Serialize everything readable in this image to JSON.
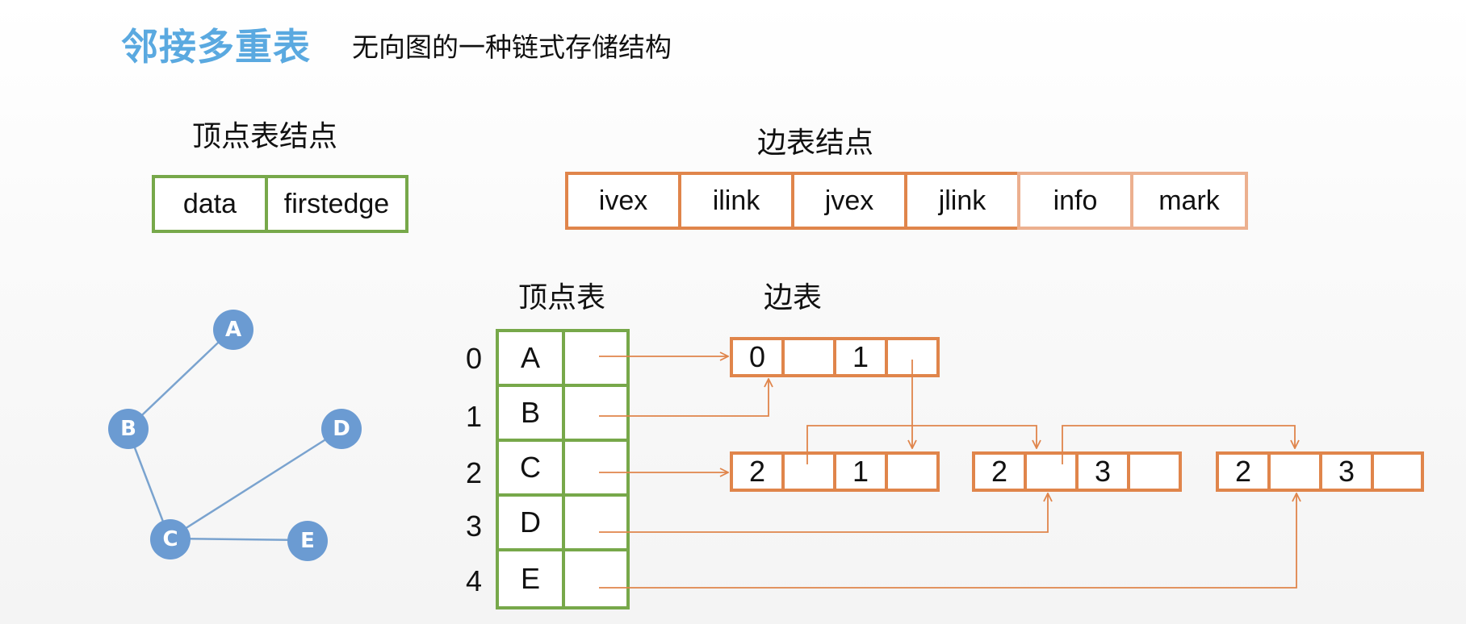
{
  "header": {
    "title": "邻接多重表",
    "subtitle": "无向图的一种链式存储结构"
  },
  "vertex_node": {
    "label": "顶点表结点",
    "fields": [
      "data",
      "firstedge"
    ]
  },
  "edge_node": {
    "label": "边表结点",
    "fields": [
      "ivex",
      "ilink",
      "jvex",
      "jlink",
      "info",
      "mark"
    ]
  },
  "graph": {
    "vertices": [
      "A",
      "B",
      "C",
      "D",
      "E"
    ],
    "edges": [
      [
        "A",
        "B"
      ],
      [
        "B",
        "C"
      ],
      [
        "C",
        "D"
      ],
      [
        "C",
        "E"
      ]
    ]
  },
  "vertex_table": {
    "label": "顶点表",
    "indices": [
      "0",
      "1",
      "2",
      "3",
      "4"
    ],
    "rows": [
      "A",
      "B",
      "C",
      "D",
      "E"
    ]
  },
  "edge_table": {
    "label": "边表",
    "nodes": [
      {
        "ivex": "0",
        "jvex": "1"
      },
      {
        "ivex": "2",
        "jvex": "1"
      },
      {
        "ivex": "2",
        "jvex": "3"
      },
      {
        "ivex": "2",
        "jvex": "3"
      }
    ]
  },
  "colors": {
    "title": "#5aa9e0",
    "vertex_border": "#77a84a",
    "edge_border": "#e0854b",
    "edge_border_light": "#ecb08f",
    "graph_node": "#6b9bd2",
    "graph_edge": "#7aa3cf",
    "arrow": "#e0854b"
  }
}
